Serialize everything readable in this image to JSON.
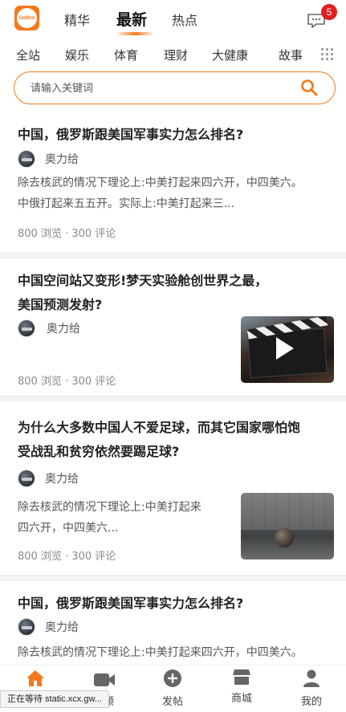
{
  "header": {
    "logo_text": "Golfinn",
    "primary_tabs": [
      {
        "label": "精华"
      },
      {
        "label": "最新"
      },
      {
        "label": "热点"
      }
    ],
    "active_tab": "最新",
    "message_badge": "5"
  },
  "categories": [
    "全站",
    "娱乐",
    "体育",
    "理财",
    "大健康",
    "故事"
  ],
  "search": {
    "placeholder": "请输入关键词"
  },
  "feed": [
    {
      "title": "中国，俄罗斯跟美国军事实力怎么排名?",
      "author": "奥力给",
      "summary_lines": [
        "除去核武的情况下理论上:中美打起来四六开，中四美六。",
        "中俄打起来五五开。实际上:中美打起来三..."
      ],
      "stats": "800 浏览 · 300 评论"
    },
    {
      "title_lines": [
        "中国空间站又变形!梦天实验舱创世界之最，",
        "美国预测发射?"
      ],
      "author": "奥力给",
      "stats": "800 浏览 · 300 评论",
      "thumb": "video-clapperboard"
    },
    {
      "title_lines": [
        "为什么大多数中国人不爱足球，而其它国家哪怕饱",
        "受战乱和贫穷依然要踢足球?"
      ],
      "author": "奥力给",
      "summary_lines": [
        "除去核武的情况下理论上:中美打起来",
        "四六开，中四美六..."
      ],
      "stats": "800 浏览 · 300 评论",
      "thumb": "football-image"
    },
    {
      "title": "中国，俄罗斯跟美国军事实力怎么排名?",
      "author": "奥力给",
      "summary_lines": [
        "除去核武的情况下理论上:中美打起来四六开，中四美六。"
      ]
    }
  ],
  "bottom_nav": [
    {
      "label": "",
      "icon": "home-icon",
      "active": true
    },
    {
      "label": "视频",
      "icon": "video-icon"
    },
    {
      "label": "发帖",
      "icon": "add-post-icon"
    },
    {
      "label": "商城",
      "icon": "store-icon"
    },
    {
      "label": "我的",
      "icon": "profile-icon"
    }
  ],
  "status_bar": "正在等待 static.xcx.gw...",
  "colors": {
    "accent": "#f3791d",
    "badge": "#e02020"
  }
}
